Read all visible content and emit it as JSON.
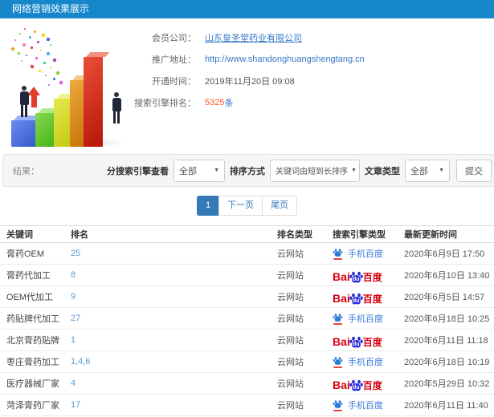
{
  "header": {
    "title": "网络营销效果展示"
  },
  "info": {
    "fields": [
      {
        "label": "会员公司：",
        "value": "山东皇圣堂药业有限公司"
      },
      {
        "label": "推广地址：",
        "value": "http://www.shandonghuangshengtang.cn"
      },
      {
        "label": "开通时间：",
        "value": "2019年11月20日 09:08"
      },
      {
        "label": "搜索引擎排名：",
        "value": "5325",
        "unit": "条"
      }
    ]
  },
  "filters": {
    "result_label": "结果：",
    "engine_label": "分搜索引擎查看",
    "engine_value": "全部",
    "sort_label": "排序方式",
    "sort_value": "关键词由短到长排序",
    "article_label": "文章类型",
    "article_value": "全部",
    "submit_label": "提交"
  },
  "pagination": {
    "current": "1",
    "next": "下一页",
    "last": "尾页"
  },
  "table": {
    "headers": [
      "关键词",
      "排名",
      "排名类型",
      "搜索引擎类型",
      "最新更新时间"
    ],
    "baidu_logo": {
      "bai": "Bai",
      "du": "du",
      "cn": "百度"
    },
    "rows": [
      {
        "keyword": "膏药OEM",
        "rank": "25",
        "rank_type": "云网站",
        "engine": "mobile",
        "engine_label": "手机百度",
        "updated": "2020年6月9日 17:50"
      },
      {
        "keyword": "膏药代加工",
        "rank": "8",
        "rank_type": "云网站",
        "engine": "baidu",
        "engine_label": "百度",
        "updated": "2020年6月10日 13:40"
      },
      {
        "keyword": "OEM代加工",
        "rank": "9",
        "rank_type": "云网站",
        "engine": "baidu",
        "engine_label": "百度",
        "updated": "2020年6月5日 14:57"
      },
      {
        "keyword": "药贴牌代加工",
        "rank": "27",
        "rank_type": "云网站",
        "engine": "mobile",
        "engine_label": "手机百度",
        "updated": "2020年6月18日 10:25"
      },
      {
        "keyword": "北京膏药贴牌",
        "rank": "1",
        "rank_type": "云网站",
        "engine": "baidu",
        "engine_label": "百度",
        "updated": "2020年6月11日 11:18"
      },
      {
        "keyword": "枣庄膏药加工",
        "rank": "1,4,6",
        "rank_type": "云网站",
        "engine": "mobile",
        "engine_label": "手机百度",
        "updated": "2020年6月18日 10:19"
      },
      {
        "keyword": "医疗器械厂家",
        "rank": "4",
        "rank_type": "云网站",
        "engine": "baidu",
        "engine_label": "百度",
        "updated": "2020年5月29日 10:32"
      },
      {
        "keyword": "菏泽膏药厂家",
        "rank": "17",
        "rank_type": "云网站",
        "engine": "mobile",
        "engine_label": "手机百度",
        "updated": "2020年6月11日 11:40"
      }
    ]
  },
  "colors": {
    "header_blue": "#1787cb",
    "link_blue": "#3577c8",
    "count_orange": "#ff5722",
    "pagination_blue": "#337ab7",
    "rank_blue": "#5a9bd4",
    "baidu_red": "#d70010",
    "baidu_blue": "#2629de",
    "mobile_baidu_blue": "#3a7ad9"
  },
  "icons": [
    "baidu-paw-icon",
    "mobile-baidu-icon",
    "growth-arrow-icon",
    "caret-down-icon"
  ]
}
